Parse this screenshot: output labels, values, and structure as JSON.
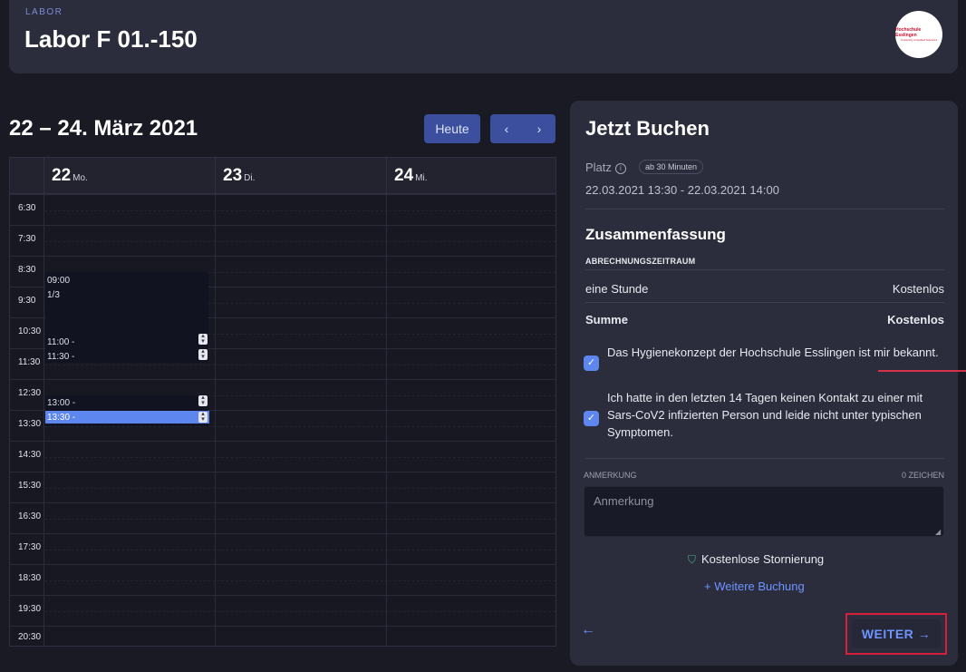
{
  "header": {
    "category": "LABOR",
    "title": "Labor F 01.-150",
    "logo_line1": "Hochschule Esslingen",
    "logo_line2": "University of Applied Sciences"
  },
  "calendar": {
    "title": "22 – 24. März 2021",
    "today_label": "Heute",
    "prev_label": "‹",
    "next_label": "›",
    "days": [
      {
        "num": "22",
        "name": "Mo."
      },
      {
        "num": "23",
        "name": "Di."
      },
      {
        "num": "24",
        "name": "Mi."
      }
    ],
    "times": [
      "6:30",
      "7:30",
      "8:30",
      "9:30",
      "10:30",
      "11:30",
      "12:30",
      "13:30",
      "14:30",
      "15:30",
      "16:30",
      "17:30",
      "18:30",
      "19:30",
      "20:30"
    ],
    "events": {
      "a_time": "09:00",
      "a_count": "1/3",
      "b_start": "11:00 -",
      "b_end": "11:30 -",
      "c_start": "13:00 -",
      "c_selected": "13:30 -"
    }
  },
  "booking": {
    "title": "Jetzt Buchen",
    "platz_label": "Platz",
    "info_icon": "ⓘ",
    "min_badge": "ab 30 Minuten",
    "date_range": "22.03.2021 13:30 - 22.03.2021 14:00",
    "summary_title": "Zusammenfassung",
    "billing_label": "ABRECHNUNGSZEITRAUM",
    "row_label": "eine Stunde",
    "row_value": "Kostenlos",
    "sum_label": "Summe",
    "sum_value": "Kostenlos",
    "check1": "Das Hygienekonzept der Hochschule Esslingen ist mir bekannt.",
    "check2": "Ich hatte in den letzten 14 Tagen keinen Kontakt zu einer mit Sars-CoV2 infizierten Person und leide nicht unter typischen Symptomen.",
    "note_label": "ANMERKUNG",
    "note_count": "0 ZEICHEN",
    "note_placeholder": "Anmerkung",
    "storno": "Kostenlose Stornierung",
    "more_booking": "+ Weitere Buchung",
    "back_icon": "←",
    "weiter": "WEITER →"
  },
  "colors": {
    "background": "#191a24",
    "panel": "#2b2d3d",
    "accent": "#5d86ef",
    "highlight": "#d61f3a"
  }
}
